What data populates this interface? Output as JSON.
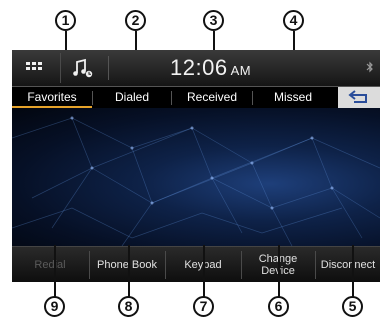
{
  "callouts": {
    "top": [
      "1",
      "2",
      "3",
      "4"
    ],
    "bottom": [
      "9",
      "8",
      "7",
      "6",
      "5"
    ]
  },
  "status_bar": {
    "time": "12:06",
    "ampm": "AM",
    "icons": [
      "apps-grid-icon",
      "music-note-icon",
      "bluetooth-icon"
    ]
  },
  "tabs": [
    {
      "label": "Favorites",
      "active": true
    },
    {
      "label": "Dialed",
      "active": false
    },
    {
      "label": "Received",
      "active": false
    },
    {
      "label": "Missed",
      "active": false
    }
  ],
  "back_button": {
    "icon": "back-arrow-icon"
  },
  "bottom_buttons": [
    {
      "label": "Redial",
      "enabled": false
    },
    {
      "label": "Phone Book",
      "enabled": true
    },
    {
      "label": "Keypad",
      "enabled": true
    },
    {
      "label": "Change Device",
      "enabled": true
    },
    {
      "label": "Disconnect",
      "enabled": true
    }
  ],
  "colors": {
    "active_tab_underline": "#e6a32a",
    "background": "#000000",
    "wallpaper": "#0e2248"
  }
}
